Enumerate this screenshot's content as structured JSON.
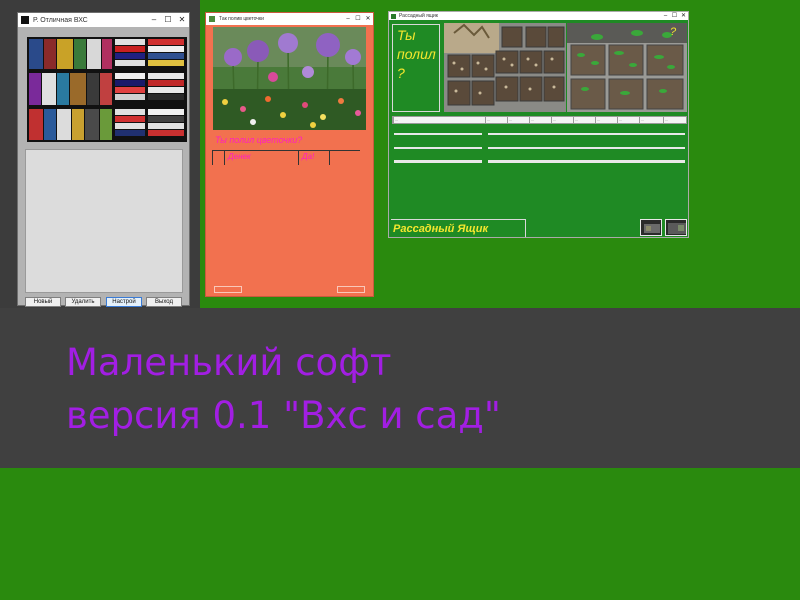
{
  "banner": {
    "line1": "Маленький софт",
    "line2": "версия 0.1 \"Вхс и сад\""
  },
  "vhs_window": {
    "title": "Р. Отличная ВХС",
    "buttons": [
      "Новый",
      "Удалить",
      "Настрой",
      "Выход"
    ]
  },
  "flower_window": {
    "title": "Так полив цветочки",
    "question": "Ты полил цветочки?",
    "columns": [
      "",
      "Денек",
      "Да!",
      ""
    ]
  },
  "seedling_window": {
    "title": "Рассадный ящик",
    "question_text": "Ты\nполил\n?",
    "side_mark": "?",
    "header_cells": [
      "...",
      "...",
      "...",
      "...",
      "...",
      "...",
      "...",
      "...",
      "...",
      "..."
    ],
    "footer_label": "Рассадный Ящик"
  },
  "colors": {
    "green_bg": "#2a8a0e",
    "banner_bg": "#404040",
    "banner_text": "#a21ee3",
    "flower_window_bg": "#f2714f",
    "flower_text": "#ff1fbf",
    "seed_window_bg": "#1f8a24",
    "seed_text": "#f5e72e"
  },
  "icons": {
    "minimize": "minimize-icon",
    "maximize": "maximize-icon",
    "close": "close-icon"
  }
}
